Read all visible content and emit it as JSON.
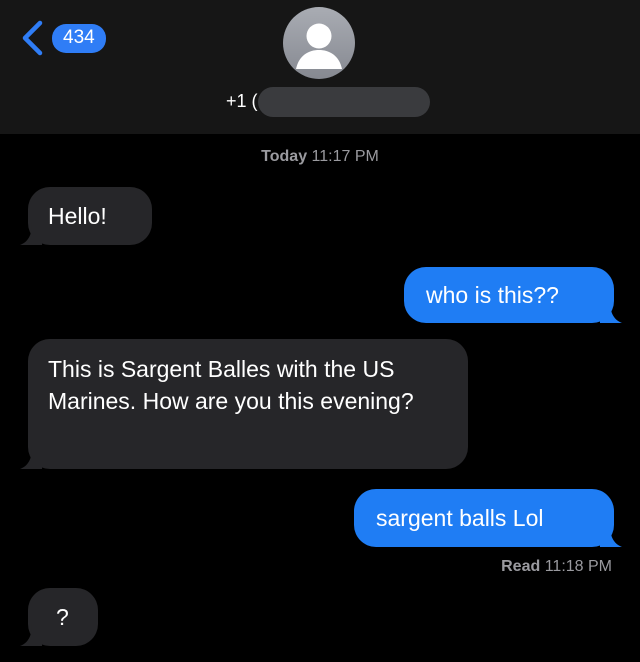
{
  "header": {
    "back_badge": "434",
    "contact_prefix": "+1 ("
  },
  "timestamp": {
    "day": "Today",
    "time": "11:17 PM"
  },
  "messages": [
    {
      "direction": "in",
      "text": "Hello!"
    },
    {
      "direction": "out",
      "text": "who is this??"
    },
    {
      "direction": "in",
      "text": "This is Sargent Balles with the US Marines. How are you this evening?"
    },
    {
      "direction": "out",
      "text": "sargent balls Lol"
    },
    {
      "direction": "in",
      "text": "?"
    }
  ],
  "read_receipt": {
    "label": "Read",
    "time": "11:18 PM"
  },
  "colors": {
    "incoming_bubble": "#262629",
    "outgoing_bubble": "#1f7df4",
    "accent": "#2f7df6",
    "header_bg": "#161616"
  },
  "icons": {
    "back": "chevron-left-icon",
    "avatar": "person-silhouette-icon"
  }
}
